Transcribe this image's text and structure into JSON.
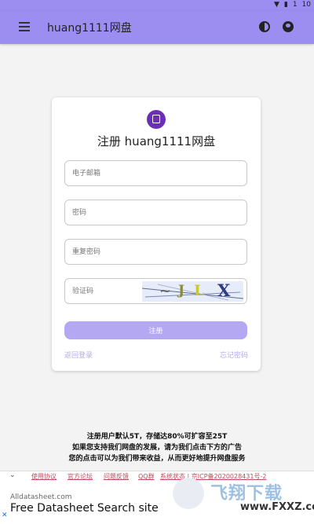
{
  "status_bar": {
    "battery": "1",
    "right_label": "10"
  },
  "app_bar": {
    "title": "huang1111网盘"
  },
  "register": {
    "title": "注册 huang1111网盘",
    "email_placeholder": "电子邮箱",
    "password_placeholder": "密码",
    "repeat_password_placeholder": "重复密码",
    "captcha_placeholder": "验证码",
    "captcha_chars": [
      "~",
      "J",
      "L",
      "X"
    ],
    "submit_label": "注册",
    "back_link": "返回登录",
    "forgot_link": "忘记密码"
  },
  "notice": {
    "line1": "注册用户默认5T，存储达80%可扩容至25T",
    "line2": "如果您支持我们网盘的发展，请为我们点击下方的广告",
    "line3": "您的点击可以为我们带来收益，从而更好地提升网盘服务"
  },
  "footer": {
    "links": [
      "使用协议",
      "官方论坛",
      "问题反馈",
      "QQ群",
      "系统状态 | 京ICP备2020028431号-2"
    ]
  },
  "ad": {
    "domain": "Alldatasheet.com",
    "headline": "Free Datasheet Search site",
    "close_symbol": "✕"
  },
  "watermark": {
    "title": "飞翔下载",
    "subtitle": "www.FXXZ.com"
  },
  "colors": {
    "app_bar": "#9b8ef0",
    "button": "#b4a8f3",
    "logo": "#6a2fb4",
    "footer_link": "#c24a5a"
  }
}
